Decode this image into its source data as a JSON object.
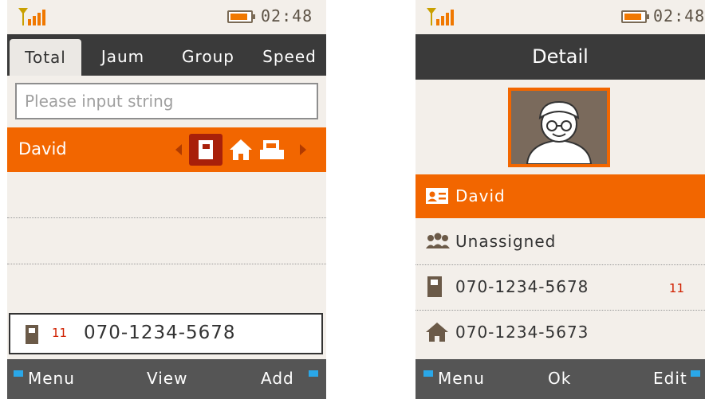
{
  "left": {
    "status": {
      "time": "02:48"
    },
    "tabs": [
      "Total",
      "Jaum",
      "Group",
      "Speed"
    ],
    "search": {
      "placeholder": "Please input string"
    },
    "selected_contact": {
      "name": "David"
    },
    "number_box": {
      "speed_dial": "11",
      "number": "070-1234-5678"
    },
    "softkeys": {
      "left": "Menu",
      "center": "View",
      "right": "Add"
    }
  },
  "right": {
    "status": {
      "time": "02:48"
    },
    "title": "Detail",
    "rows": [
      {
        "label": "David",
        "icon": "contact-card-icon"
      },
      {
        "label": "Unassigned",
        "icon": "group-icon"
      },
      {
        "label": "070-1234-5678",
        "icon": "mobile-icon",
        "badge": "11"
      },
      {
        "label": "070-1234-5673",
        "icon": "home-icon"
      }
    ],
    "softkeys": {
      "left": "Menu",
      "center": "Ok",
      "right": "Edit"
    }
  },
  "colors": {
    "accent": "#f26600",
    "dark_bar": "#3a3a3a",
    "softbar": "#555555",
    "background": "#f3efea",
    "softkey_marker": "#2aa7e8"
  }
}
